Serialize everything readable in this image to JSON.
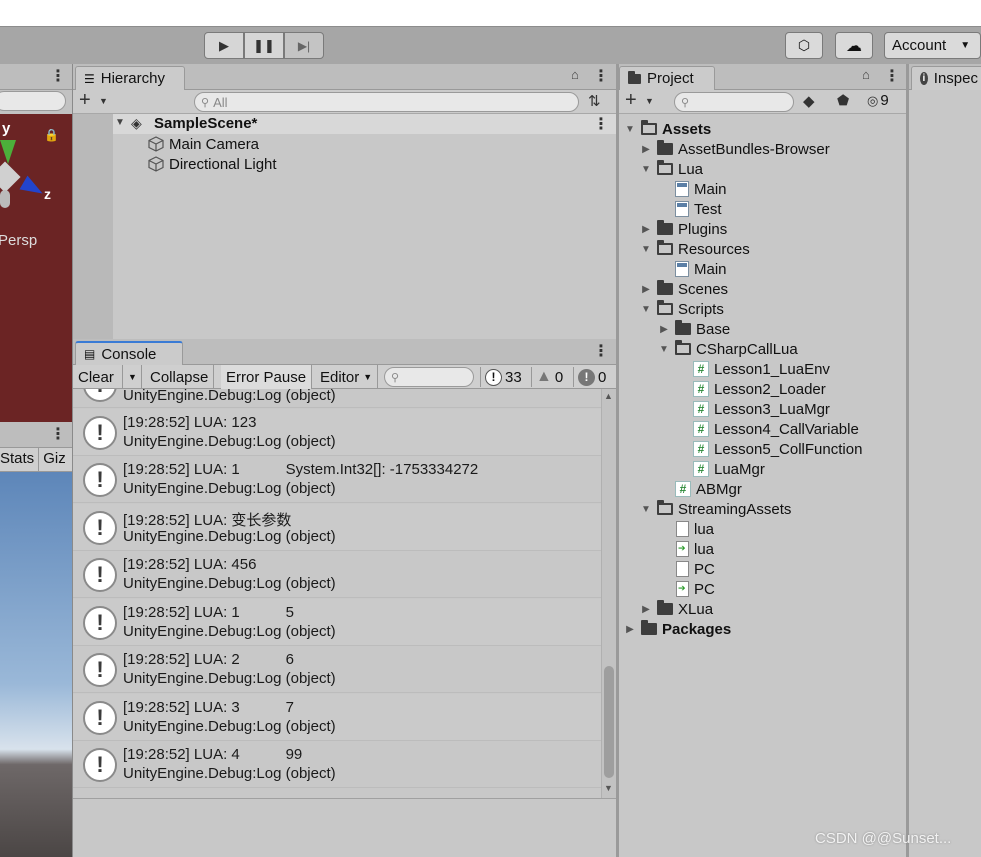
{
  "toolbar": {
    "account_label": "Account"
  },
  "scene_view": {
    "axis_y": "y",
    "axis_z": "z",
    "persp": "Persp"
  },
  "game_view": {
    "stats": "Stats",
    "gizmos": "Giz"
  },
  "hierarchy": {
    "tab": "Hierarchy",
    "search_placeholder": "All",
    "scene": "SampleScene*",
    "items": [
      "Main Camera",
      "Directional Light"
    ]
  },
  "console": {
    "tab": "Console",
    "clear": "Clear",
    "collapse": "Collapse",
    "error_pause": "Error Pause",
    "editor": "Editor",
    "count_log": "33",
    "count_warn": "0",
    "count_error": "0",
    "partial_line": "UnityEngine.Debug:Log (object)",
    "logs": [
      {
        "l1": "[19:28:52] LUA: 123",
        "l2": "UnityEngine.Debug:Log (object)"
      },
      {
        "l1": "[19:28:52] LUA: 1           System.Int32[]: -1753334272",
        "l2": "UnityEngine.Debug:Log (object)"
      },
      {
        "l1": "[19:28:52] LUA: 变长参数",
        "l2": "UnityEngine.Debug:Log (object)"
      },
      {
        "l1": "[19:28:52] LUA: 456",
        "l2": "UnityEngine.Debug:Log (object)"
      },
      {
        "l1": "[19:28:52] LUA: 1           5",
        "l2": "UnityEngine.Debug:Log (object)"
      },
      {
        "l1": "[19:28:52] LUA: 2           6",
        "l2": "UnityEngine.Debug:Log (object)"
      },
      {
        "l1": "[19:28:52] LUA: 3           7",
        "l2": "UnityEngine.Debug:Log (object)"
      },
      {
        "l1": "[19:28:52] LUA: 4           99",
        "l2": "UnityEngine.Debug:Log (object)"
      }
    ]
  },
  "project": {
    "tab": "Project",
    "hidden_count": "9",
    "tree": [
      {
        "label": "Assets",
        "bold": true
      },
      {
        "label": "AssetBundles-Browser"
      },
      {
        "label": "Lua"
      },
      {
        "label": "Main"
      },
      {
        "label": "Test"
      },
      {
        "label": "Plugins"
      },
      {
        "label": "Resources"
      },
      {
        "label": "Main"
      },
      {
        "label": "Scenes"
      },
      {
        "label": "Scripts"
      },
      {
        "label": "Base"
      },
      {
        "label": "CSharpCallLua"
      },
      {
        "label": "Lesson1_LuaEnv"
      },
      {
        "label": "Lesson2_Loader"
      },
      {
        "label": "Lesson3_LuaMgr"
      },
      {
        "label": "Lesson4_CallVariable"
      },
      {
        "label": "Lesson5_CollFunction"
      },
      {
        "label": "LuaMgr"
      },
      {
        "label": "ABMgr"
      },
      {
        "label": "StreamingAssets"
      },
      {
        "label": "lua"
      },
      {
        "label": "lua"
      },
      {
        "label": "PC"
      },
      {
        "label": "PC"
      },
      {
        "label": "XLua"
      },
      {
        "label": "Packages",
        "bold": true
      }
    ]
  },
  "inspector": {
    "tab": "Inspec"
  },
  "watermark": "CSDN @@Sunset..."
}
